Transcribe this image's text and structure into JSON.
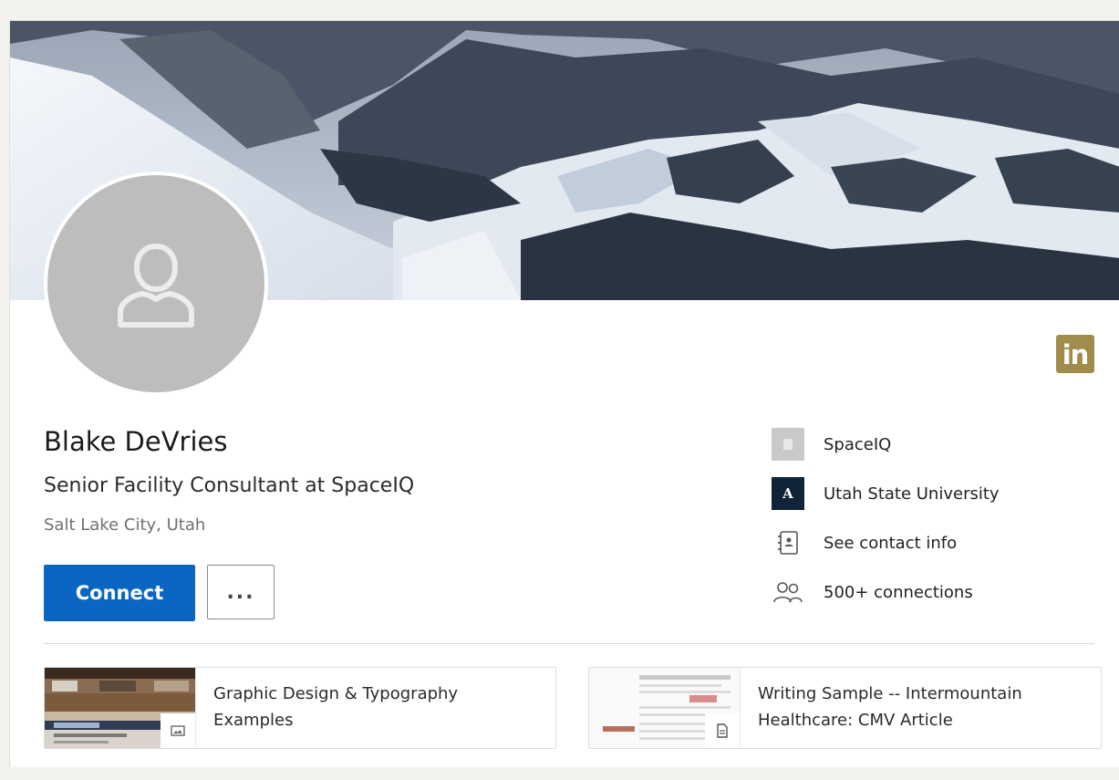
{
  "profile": {
    "name": "Blake DeVries",
    "headline": "Senior Facility Consultant at SpaceIQ",
    "location": "Salt Lake City, Utah",
    "linkedin_badge": "in",
    "avatar_icon": "person-silhouette-icon"
  },
  "actions": {
    "connect_label": "Connect",
    "more_label": "..."
  },
  "sidebar": {
    "items": [
      {
        "label": "SpaceIQ",
        "icon": "company-logo-icon"
      },
      {
        "label": "Utah State University",
        "icon": "school-logo-icon",
        "logo_text": "A"
      },
      {
        "label": "See contact info",
        "icon": "contact-card-icon"
      },
      {
        "label": "500+ connections",
        "icon": "people-icon"
      }
    ]
  },
  "featured": [
    {
      "title": "Graphic Design & Typography Examples",
      "type_icon": "image-icon"
    },
    {
      "title": "Writing Sample -- Intermountain Healthcare: CMV Article",
      "type_icon": "document-icon"
    }
  ],
  "colors": {
    "primary": "#0a66c2",
    "linkedin_badge": "#a08c4b",
    "avatar_bg": "#bdbdbd",
    "school_logo_bg": "#0f2439"
  }
}
